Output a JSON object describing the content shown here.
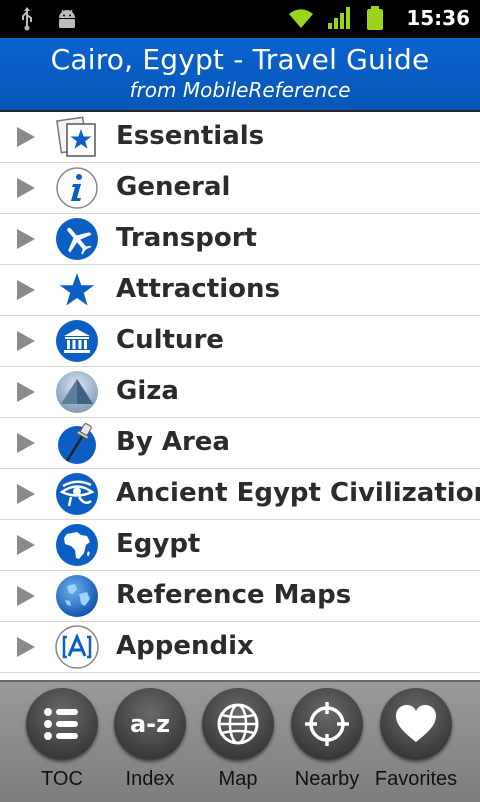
{
  "status_bar": {
    "time": "15:36"
  },
  "header": {
    "title": "Cairo, Egypt - Travel Guide",
    "subtitle": "from MobileReference"
  },
  "menu": {
    "items": [
      {
        "label": "Essentials",
        "icon": "essentials-star-icon"
      },
      {
        "label": "General",
        "icon": "info-icon"
      },
      {
        "label": "Transport",
        "icon": "airplane-icon"
      },
      {
        "label": "Attractions",
        "icon": "star-icon"
      },
      {
        "label": "Culture",
        "icon": "museum-icon"
      },
      {
        "label": "Giza",
        "icon": "pyramid-icon"
      },
      {
        "label": "By Area",
        "icon": "pushpin-icon"
      },
      {
        "label": "Ancient Egypt Civilization",
        "icon": "eye-of-horus-icon"
      },
      {
        "label": "Egypt",
        "icon": "africa-icon"
      },
      {
        "label": "Reference Maps",
        "icon": "globe-icon"
      },
      {
        "label": "Appendix",
        "icon": "appendix-icon"
      }
    ]
  },
  "tabbar": {
    "tabs": [
      {
        "label": "TOC",
        "icon": "list-icon"
      },
      {
        "label": "Index",
        "icon": "a-z-icon"
      },
      {
        "label": "Map",
        "icon": "globe-icon"
      },
      {
        "label": "Nearby",
        "icon": "crosshair-icon"
      },
      {
        "label": "Favorites",
        "icon": "heart-icon"
      }
    ],
    "index_glyph": "a-z"
  },
  "colors": {
    "header_blue": "#0a63cf",
    "icon_blue": "#0b5fc4",
    "battery_green": "#9bd41a"
  }
}
